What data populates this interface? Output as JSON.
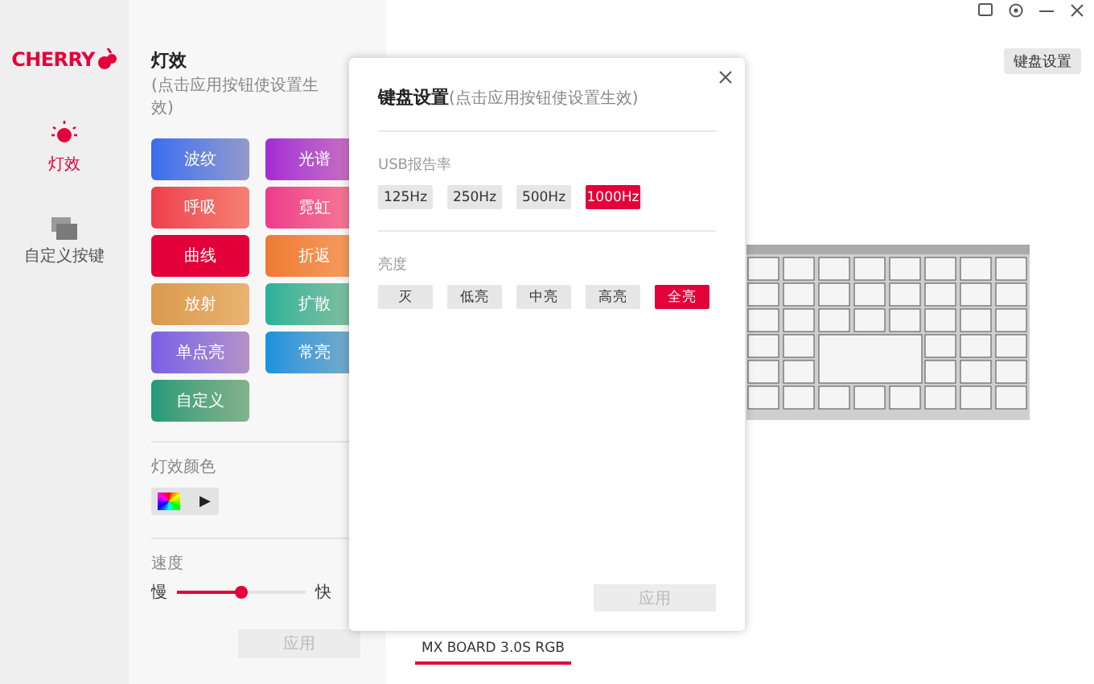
{
  "sidebar": {
    "logo": "CHERRY",
    "items": [
      {
        "label": "灯效",
        "kind": "light",
        "selected": true
      },
      {
        "label": "自定义按键",
        "kind": "keys",
        "selected": false
      }
    ]
  },
  "effects_panel": {
    "title": "灯效",
    "hint": "(点击应用按钮使设置生效)",
    "effects": [
      {
        "label": "波纹",
        "color": "#3a6cf0",
        "selected": false
      },
      {
        "label": "光谱",
        "color": "#a32ad6",
        "selected": false
      },
      {
        "label": "呼吸",
        "color": "#ee3d4d",
        "selected": false
      },
      {
        "label": "霓虹",
        "color": "#ee3a8c",
        "selected": false
      },
      {
        "label": "曲线",
        "color": "#e4003a",
        "selected": true
      },
      {
        "label": "折返",
        "color": "#ef7a32",
        "selected": false
      },
      {
        "label": "放射",
        "color": "#d99a4c",
        "selected": false
      },
      {
        "label": "扩散",
        "color": "#25b39b",
        "selected": false
      },
      {
        "label": "单点亮",
        "color": "#7a5ee8",
        "selected": false
      },
      {
        "label": "常亮",
        "color": "#1592e0",
        "selected": false
      },
      {
        "label": "自定义",
        "color": "#1e9a7a",
        "selected": false
      }
    ],
    "color_label": "灯效颜色",
    "play_label": "▶",
    "speed": {
      "label": "速度",
      "min_label": "慢",
      "max_label": "快",
      "level": 0.5
    },
    "apply": {
      "label": "应用",
      "disabled": true
    }
  },
  "header": {
    "keyboard_settings_button": "键盘设置"
  },
  "device_tab": {
    "label": "MX BOARD 3.0S RGB",
    "selected": true
  },
  "dialog": {
    "title": "键盘设置",
    "hint": "(点击应用按钮使设置生效)",
    "sections": [
      {
        "label": "USB报告率",
        "options": [
          {
            "label": "125Hz",
            "selected": false
          },
          {
            "label": "250Hz",
            "selected": false
          },
          {
            "label": "500Hz",
            "selected": false
          },
          {
            "label": "1000Hz",
            "selected": true
          }
        ]
      },
      {
        "label": "亮度",
        "options": [
          {
            "label": "灭",
            "selected": false
          },
          {
            "label": "低亮",
            "selected": false
          },
          {
            "label": "中亮",
            "selected": false
          },
          {
            "label": "高亮",
            "selected": false
          },
          {
            "label": "全亮",
            "selected": true
          }
        ]
      }
    ],
    "apply": {
      "label": "应用",
      "disabled": true
    }
  }
}
